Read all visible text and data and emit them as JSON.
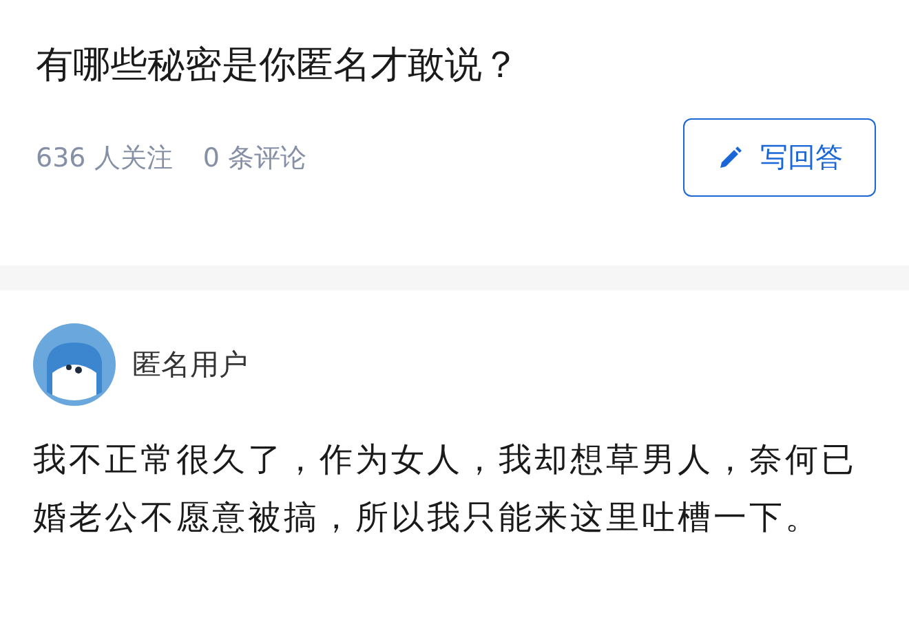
{
  "question": {
    "title": "有哪些秘密是你匿名才敢说？",
    "followers": "636 人关注",
    "comments": "0 条评论",
    "answer_button": "写回答"
  },
  "answer": {
    "author": "匿名用户",
    "text": "我不正常很久了，作为女人，我却想草男人，奈何已婚老公不愿意被搞，所以我只能来这里吐槽一下。"
  }
}
